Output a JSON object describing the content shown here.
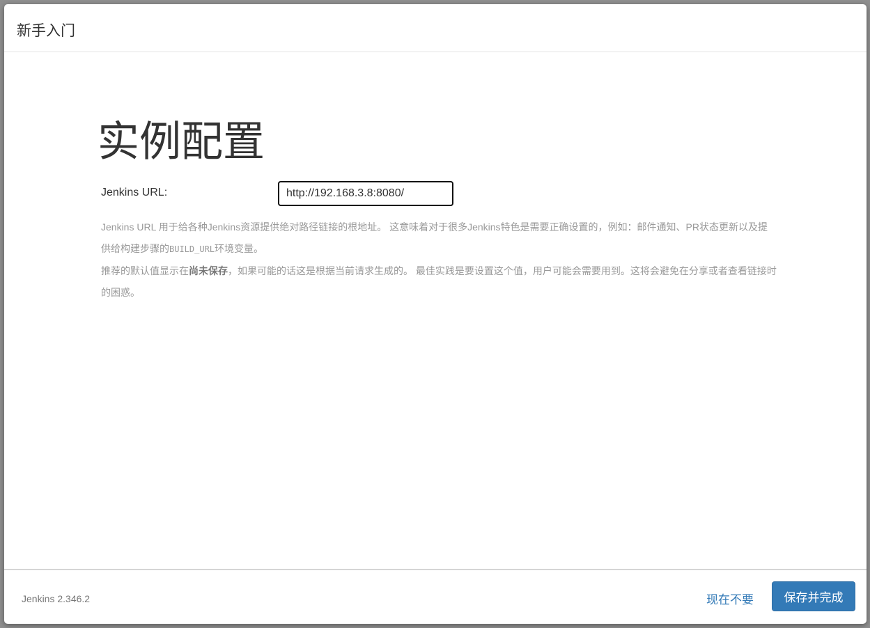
{
  "header": {
    "title": "新手入门"
  },
  "main": {
    "title": "实例配置",
    "url_label": "Jenkins URL:",
    "url_value": "http://192.168.3.8:8080/",
    "help": {
      "p1_a": "Jenkins URL 用于给各种Jenkins资源提供绝对路径链接的根地址。 这意味着对于很多Jenkins特色是需要正确设置的，例如：邮件通知、PR状态更新以及提供给构建步骤的",
      "p1_code": "BUILD_URL",
      "p1_b": "环境变量。",
      "p2_a": "推荐的默认值显示在",
      "p2_bold": "尚未保存",
      "p2_b": "，如果可能的话这是根据当前请求生成的。 最佳实践是要设置这个值，用户可能会需要用到。这将会避免在分享或者查看链接时的困惑。"
    }
  },
  "footer": {
    "version": "Jenkins 2.346.2",
    "skip_label": "现在不要",
    "save_label": "保存并完成"
  },
  "colors": {
    "primary": "#337ab7"
  }
}
